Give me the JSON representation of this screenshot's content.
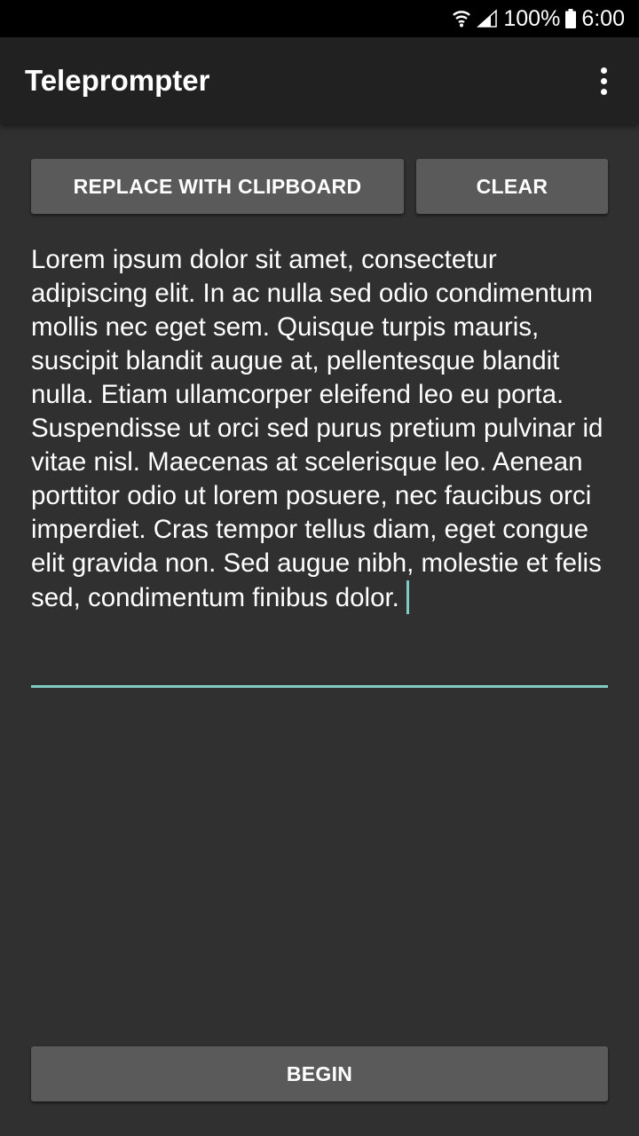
{
  "status_bar": {
    "battery": "100%",
    "time": "6:00",
    "icons": [
      "wifi-icon",
      "signal-icon",
      "battery-icon"
    ]
  },
  "app_bar": {
    "title": "Teleprompter",
    "menu_icon": "more-vert-icon"
  },
  "buttons": {
    "replace": "REPLACE WITH CLIPBOARD",
    "clear": "CLEAR",
    "begin": "BEGIN"
  },
  "editor": {
    "text": "Lorem ipsum dolor sit amet, consectetur adipiscing elit. In ac nulla sed odio condimentum mollis nec eget sem. Quisque turpis mauris, suscipit blandit augue at, pellentesque blandit nulla. Etiam ullamcorper eleifend leo eu porta. Suspendisse ut orci sed purus pretium pulvinar id vitae nisl. Maecenas at scelerisque leo. Aenean porttitor odio ut lorem posuere, nec faucibus orci imperdiet. Cras tempor tellus diam, eget congue elit gravida non. Sed augue nibh, molestie et felis sed, condimentum finibus dolor."
  },
  "colors": {
    "background": "#303030",
    "app_bar": "#212121",
    "button": "#5a5a5b",
    "accent": "#80cbc4"
  }
}
